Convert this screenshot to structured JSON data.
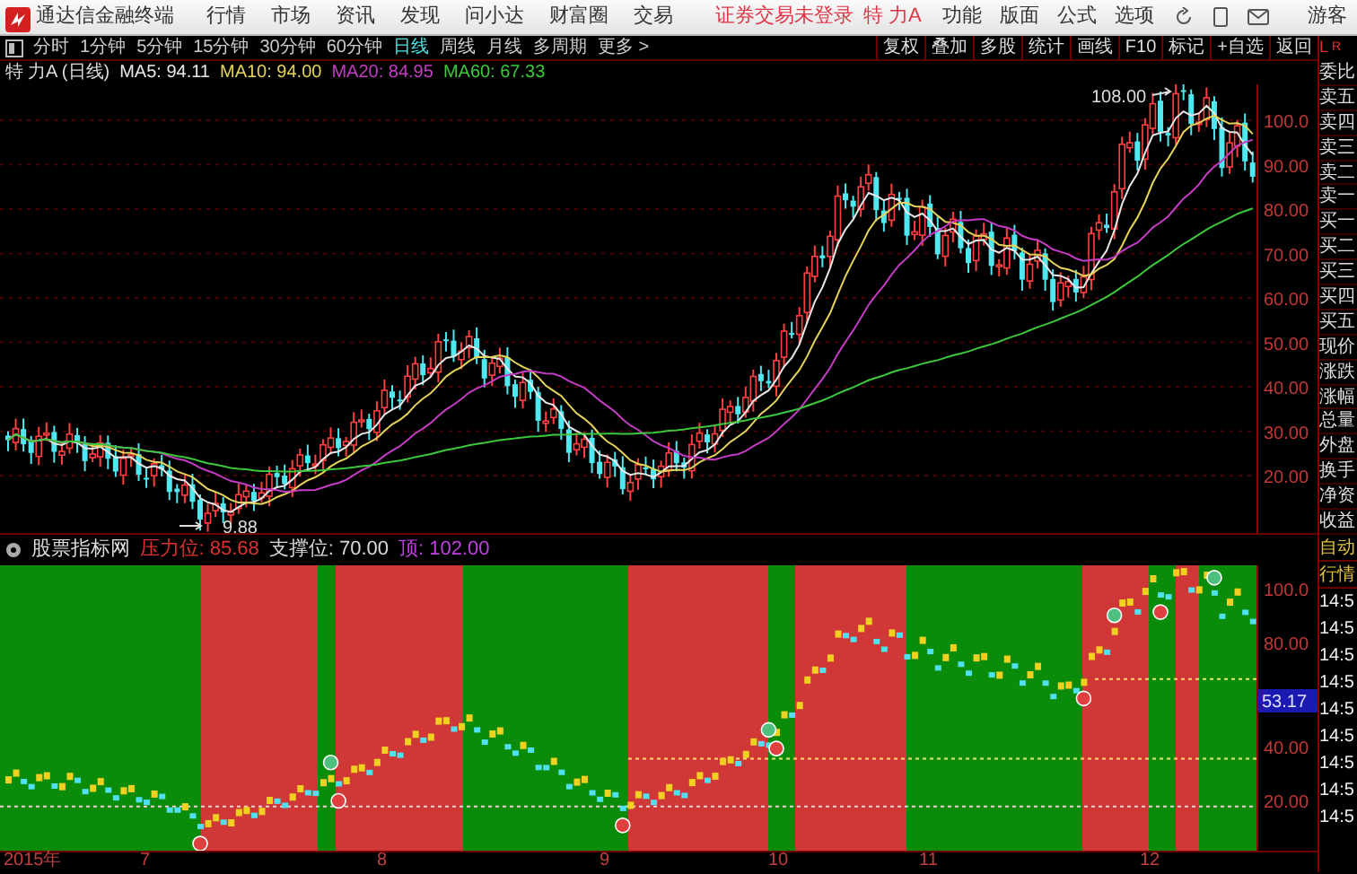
{
  "title_bar": {
    "app_title": "通达信金融终端",
    "menu": [
      "行情",
      "市场",
      "资讯",
      "发现",
      "问小达",
      "财富圈",
      "交易"
    ],
    "login_status": "证券交易未登录",
    "stock_name": "特 力A",
    "right_menu": [
      "功能",
      "版面",
      "公式",
      "选项"
    ],
    "user": "游客"
  },
  "toolbar": {
    "periods": [
      {
        "label": "分时",
        "selected": false
      },
      {
        "label": "1分钟",
        "selected": false
      },
      {
        "label": "5分钟",
        "selected": false
      },
      {
        "label": "15分钟",
        "selected": false
      },
      {
        "label": "30分钟",
        "selected": false
      },
      {
        "label": "60分钟",
        "selected": false
      },
      {
        "label": "日线",
        "selected": true
      },
      {
        "label": "周线",
        "selected": false
      },
      {
        "label": "月线",
        "selected": false
      },
      {
        "label": "多周期",
        "selected": false
      },
      {
        "label": "更多 >",
        "selected": false
      }
    ],
    "tools": [
      "复权",
      "叠加",
      "多股",
      "统计",
      "画线",
      "F10",
      "标记",
      "+自选",
      "返回"
    ]
  },
  "chart": {
    "title": "特 力A (日线)",
    "ma": [
      {
        "label": "MA5: 94.11",
        "color": "#e8e8e8"
      },
      {
        "label": "MA10: 94.00",
        "color": "#e6d45a"
      },
      {
        "label": "MA20: 84.95",
        "color": "#c43cc4"
      },
      {
        "label": "MA60: 67.33",
        "color": "#3cc83c"
      }
    ],
    "high_label": "108.00",
    "low_label": "9.88",
    "y_labels": [
      "100.0",
      "90.00",
      "80.00",
      "70.00",
      "60.00",
      "50.00",
      "40.00",
      "30.00",
      "20.00"
    ]
  },
  "indicator": {
    "name": "股票指标网",
    "values": [
      {
        "label": "压力位: 85.68",
        "color": "#e03030"
      },
      {
        "label": "支撑位: 70.00",
        "color": "#d8d8d8"
      },
      {
        "label": "顶: 102.00",
        "color": "#c040e0"
      }
    ],
    "y_labels": [
      {
        "text": "100.0",
        "kind": "tick"
      },
      {
        "text": "80.00",
        "kind": "tick"
      },
      {
        "text": "53.17",
        "kind": "current"
      },
      {
        "text": "40.00",
        "kind": "tick"
      },
      {
        "text": "20.00",
        "kind": "tick"
      }
    ]
  },
  "date_axis": [
    "2015年",
    "7",
    "8",
    "9",
    "10",
    "11",
    "12"
  ],
  "quote_panel": {
    "toggle": {
      "left": "L",
      "right": "R"
    },
    "fields": [
      "委比",
      "卖五",
      "卖四",
      "卖三",
      "卖二",
      "卖一",
      "买一",
      "买二",
      "买三",
      "买四",
      "买五",
      "现价",
      "涨跌",
      "涨幅",
      "总量",
      "外盘",
      "换手",
      "净资",
      "收益"
    ],
    "tabs": [
      "自动",
      "行情"
    ],
    "times": [
      "14:5",
      "14:5",
      "14:5",
      "14:5",
      "14:5",
      "14:5",
      "14:5",
      "14:5",
      "14:5"
    ]
  }
}
